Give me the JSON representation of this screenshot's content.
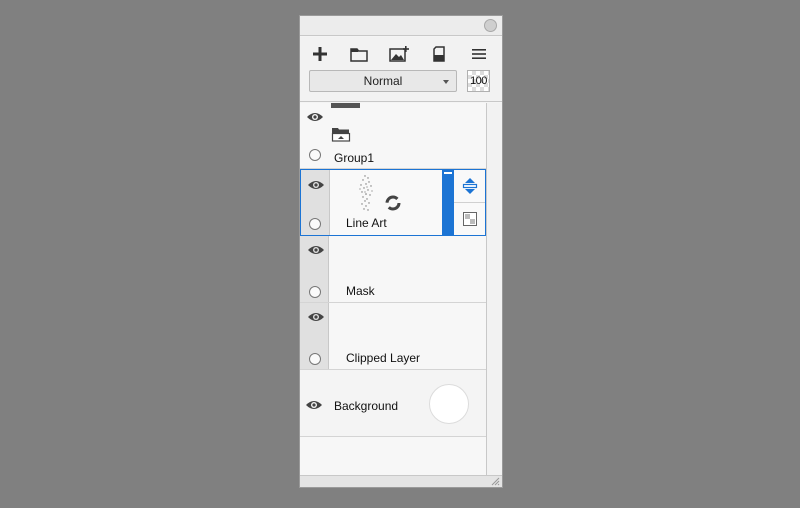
{
  "panel": {
    "toolbar": {
      "icons": [
        "add-layer-icon",
        "new-folder-icon",
        "add-image-icon",
        "eraser-icon",
        "menu-icon"
      ],
      "blend_mode": "Normal",
      "opacity": "100"
    },
    "layers": [
      {
        "name": "Group1",
        "type": "folder",
        "visible": true
      },
      {
        "name": "Line Art",
        "type": "raster",
        "visible": true,
        "selected": true
      },
      {
        "name": "Mask",
        "type": "mask",
        "visible": true
      },
      {
        "name": "Clipped Layer",
        "type": "clipped",
        "visible": true
      },
      {
        "name": "Background",
        "type": "background",
        "visible": true
      }
    ]
  },
  "colors": {
    "accent": "#1c74d4",
    "panel_bg": "#f4f4f4",
    "desktop_bg": "#808080"
  }
}
